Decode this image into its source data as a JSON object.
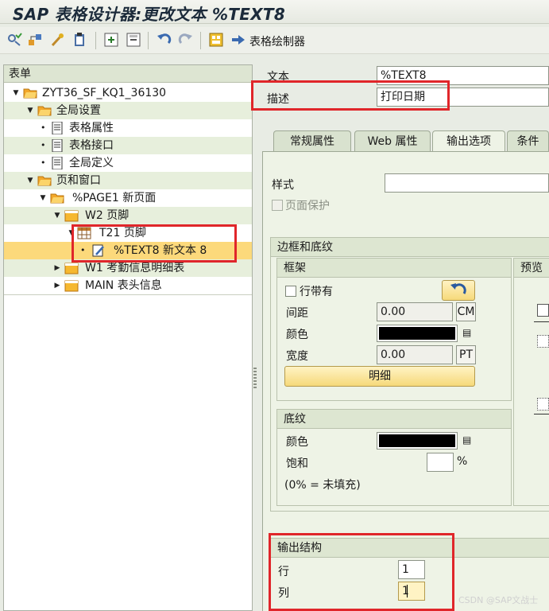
{
  "window": {
    "title": "SAP 表格设计器:更改文本 %TEXT8"
  },
  "toolbar": {
    "icons": [
      "settings-check-icon",
      "hierarchy-icon",
      "magic-wand-icon",
      "clipboard-icon",
      "insert-icon",
      "delete-icon",
      "undo-icon",
      "redo-icon",
      "form-painter-icon"
    ],
    "form_painter_label": "表格绘制器"
  },
  "tree": {
    "header": "表单",
    "items": [
      {
        "label": "ZYT36_SF_KQ1_36130"
      },
      {
        "label": "全局设置"
      },
      {
        "label": "表格属性"
      },
      {
        "label": "表格接口"
      },
      {
        "label": "全局定义"
      },
      {
        "label": "页和窗口"
      },
      {
        "label": "%PAGE1 新页面"
      },
      {
        "label": "W2 页脚"
      },
      {
        "label": "T21 页脚"
      },
      {
        "label": "%TEXT8 新文本 8"
      },
      {
        "label": "W1 考勤信息明细表"
      },
      {
        "label": "MAIN 表头信息"
      }
    ]
  },
  "detail": {
    "text_label": "文本",
    "text_value": "%TEXT8",
    "desc_label": "描述",
    "desc_value": "打印日期"
  },
  "tabs": [
    {
      "label": "常规属性"
    },
    {
      "label": "Web 属性"
    },
    {
      "label": "输出选项"
    },
    {
      "label": "条件"
    }
  ],
  "output": {
    "style_label": "样式",
    "style_value": "",
    "page_protect_label": "页面保护",
    "border_section": "边框和底纹",
    "frame": {
      "title": "框架",
      "with_line_label": "行带有",
      "spacing_label": "间距",
      "spacing_value": "0.00",
      "spacing_unit": "CM",
      "color_label": "颜色",
      "width_label": "宽度",
      "width_value": "0.00",
      "width_unit": "PT",
      "detail_button": "明细"
    },
    "preview_title": "预览",
    "shading": {
      "title": "底纹",
      "color_label": "颜色",
      "saturation_label": "饱和",
      "saturation_value": "",
      "percent": "%",
      "note": "(0% = 未填充)"
    },
    "output_structure": {
      "title": "输出结构",
      "row_label": "行",
      "row_value": "1",
      "col_label": "列",
      "col_value": "1"
    }
  },
  "watermark": "CSDN @SAP文战士",
  "colors": {
    "highlight": "#fcd97b",
    "annotation_red": "#e0262a"
  }
}
